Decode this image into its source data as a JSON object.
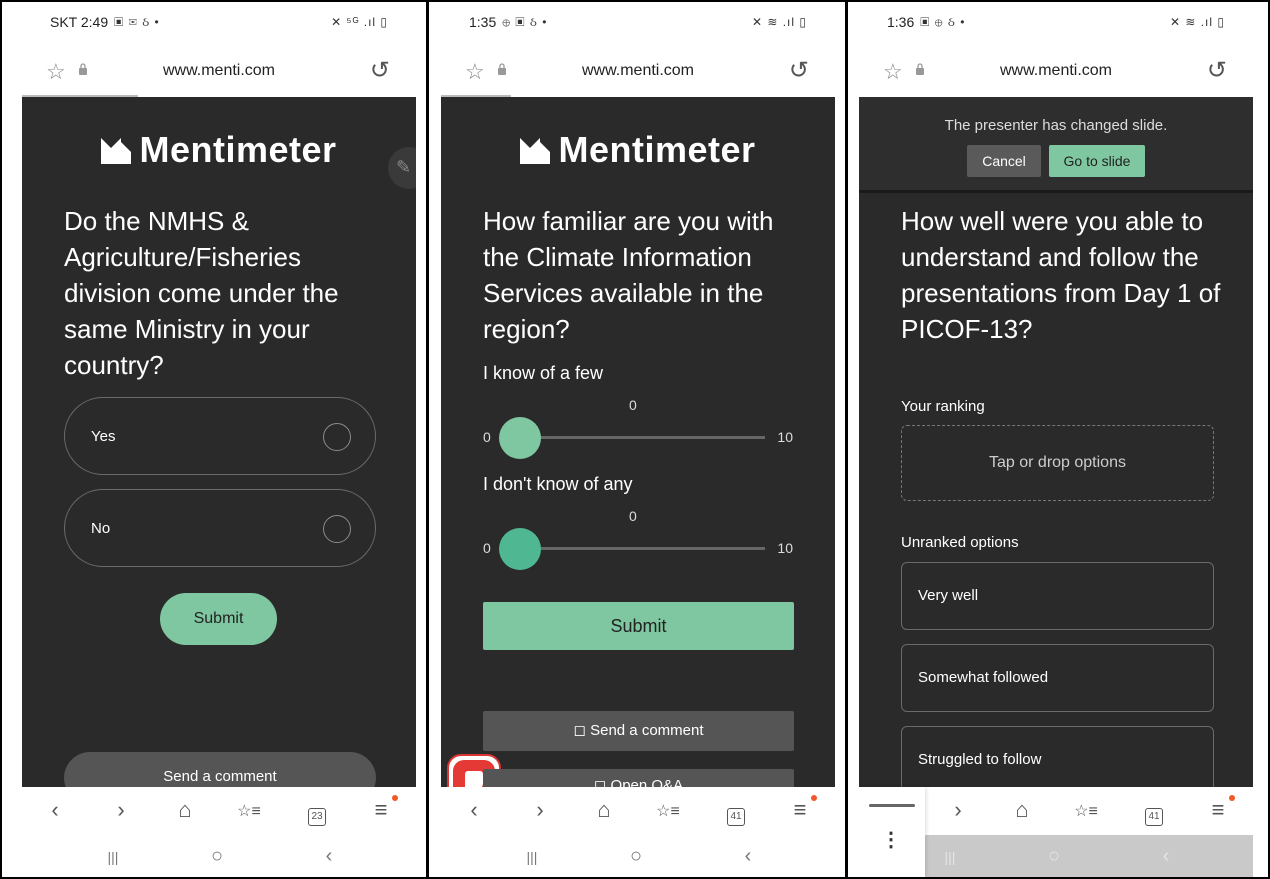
{
  "panels": [
    {
      "status": {
        "carrier_time": "SKT 2:49",
        "icons": "▣ ✉ ઠ •",
        "right_icons": "✕ ⁵ᴳ .ıl ▯"
      },
      "browser": {
        "url": "www.menti.com"
      },
      "brand": "Mentimeter",
      "question": "Do the NMHS & Agriculture/Fisheries division come under the same Ministry in your country?",
      "options": [
        "Yes",
        "No"
      ],
      "submit_label": "Submit",
      "comment_label": "Send a comment",
      "tab_count": "23"
    },
    {
      "status": {
        "carrier_time": "1:35",
        "icons": "⊕ ▣ ઠ •",
        "right_icons": "✕ ≋ .ıl ▯"
      },
      "browser": {
        "url": "www.menti.com"
      },
      "brand": "Mentimeter",
      "question": "How familiar are you with the Climate Information Services available in the region?",
      "sliders": [
        {
          "label": "I know of a few",
          "value": "0",
          "min": "0",
          "max": "10",
          "color": "#7fc7a0"
        },
        {
          "label": "I don't know of any",
          "value": "0",
          "min": "0",
          "max": "10",
          "color": "#4fb892"
        }
      ],
      "submit_label": "Submit",
      "comment_label": "Send a comment",
      "qa_label": "Open Q&A",
      "tab_count": "41"
    },
    {
      "status": {
        "carrier_time": "1:36",
        "icons": "▣ ⊕ ઠ •",
        "right_icons": "✕ ≋ .ıl ▯"
      },
      "browser": {
        "url": "www.menti.com"
      },
      "toast": {
        "message": "The presenter has changed slide.",
        "cancel": "Cancel",
        "goto": "Go to slide"
      },
      "question": "How well were you able to understand and follow the presentations from Day 1 of PICOF-13?",
      "ranking_label": "Your ranking",
      "dropzone_text": "Tap or drop options",
      "unranked_label": "Unranked options",
      "options": [
        "Very well",
        "Somewhat followed",
        "Struggled to follow"
      ],
      "tab_count": "41"
    }
  ],
  "colors": {
    "accent": "#7fc7a0",
    "background": "#2a2a2a",
    "notification_dot": "#f05a28"
  },
  "icons": {
    "bookmark": "☆",
    "reload": "↺",
    "back": "‹",
    "forward": "›",
    "home": "⌂",
    "bookmarks": "☆≡",
    "menu": "≡",
    "recents": "|||",
    "home_sys": "○",
    "back_sys": "‹",
    "pencil": "✎",
    "comment": "◻"
  }
}
